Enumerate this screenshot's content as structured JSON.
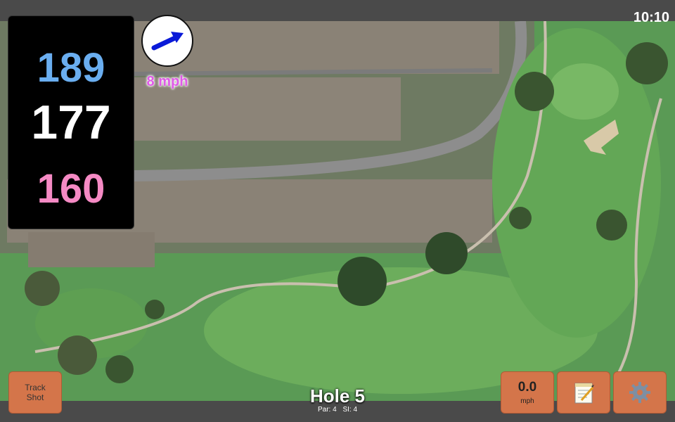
{
  "status": {
    "time": "10:10"
  },
  "distances": {
    "back": "189",
    "middle": "177",
    "front": "160"
  },
  "wind": {
    "speed_label": "8 mph",
    "direction_icon": "arrow-icon"
  },
  "hole": {
    "title": "Hole 5",
    "par": "Par: 4",
    "si": "SI: 4"
  },
  "buttons": {
    "track_line1": "Track",
    "track_line2": "Shot",
    "speed_value": "0.0",
    "speed_unit": "mph",
    "notes_icon": "notepad-icon",
    "settings_icon": "gear-icon"
  },
  "colors": {
    "back_distance": "#6aaef0",
    "middle_distance": "#ffffff",
    "front_distance": "#f58ac4",
    "button_bg": "#d4754a",
    "wind_text": "#e05ae8"
  }
}
